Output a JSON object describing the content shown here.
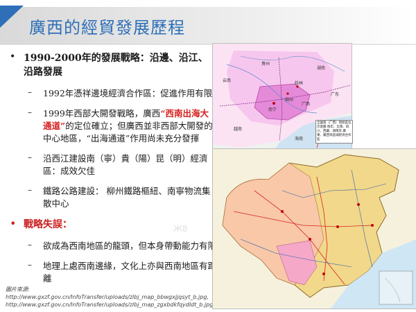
{
  "slide": {
    "title": "廣西的經貿發展歷程"
  },
  "bullets": [
    {
      "text": "1990-2000年的發展戰略：沿邊、沿江、沿路發展",
      "subs": [
        {
          "pre": "1992年憑祥邊境經濟合作區：促進作用有限",
          "hl": "",
          "post": ""
        },
        {
          "pre": "1999年西部大開發戰略，廣西",
          "hl": "“西南出海大通道”",
          "post": "的定位確立；但廣西並非西部大開發的中心地區，“出海通道”作用尚未充分發揮"
        },
        {
          "pre": "沿西江建設南（寧）貴（陽）昆（明）經濟區：成效欠佳",
          "hl": "",
          "post": ""
        },
        {
          "pre": "鐵路公路建設： 柳州鐵路樞紐、南寧物流集散中心",
          "hl": "",
          "post": ""
        }
      ]
    },
    {
      "text": "戰略失誤：",
      "subs": [
        {
          "pre": "欲成為西南地區的龍頭，但本身帶動能力有限",
          "hl": "",
          "post": ""
        },
        {
          "pre": "地理上處西南邊緣，文化上亦與西南地區有距離",
          "hl": "",
          "post": ""
        }
      ]
    }
  ],
  "source": {
    "label": "圖片來源:",
    "url1": "http://www.gxzf.gov.cn/InfoTransfer/uploads/zlbj_map_bbwgxjjqsyt_b.jpg,",
    "url2": "http://www.gxzf.gov.cn/InfoTransfer/uploads/zlbj_map_zgxbdkfqydldt_b.jpg"
  },
  "map1": {
    "labels": [
      "云南",
      "貴州",
      "湖南",
      "广西",
      "广东",
      "越南",
      "海南",
      "南宁",
      "柳州",
      "桂林"
    ],
    "note": "全國第（广西）現狀區位示意圖 每年、云南、四川、西藏、湖南及 廣東、廣西等區域經濟合作區"
  },
  "colors": {
    "title": "#2e6fb8",
    "highlight": "#d62020",
    "accent_red": "#cc1f1f",
    "guangxi_fill": "#e58ad8",
    "region_fill": "#f7c6ee"
  },
  "icons": {
    "bullet": "•",
    "dash": "–"
  }
}
